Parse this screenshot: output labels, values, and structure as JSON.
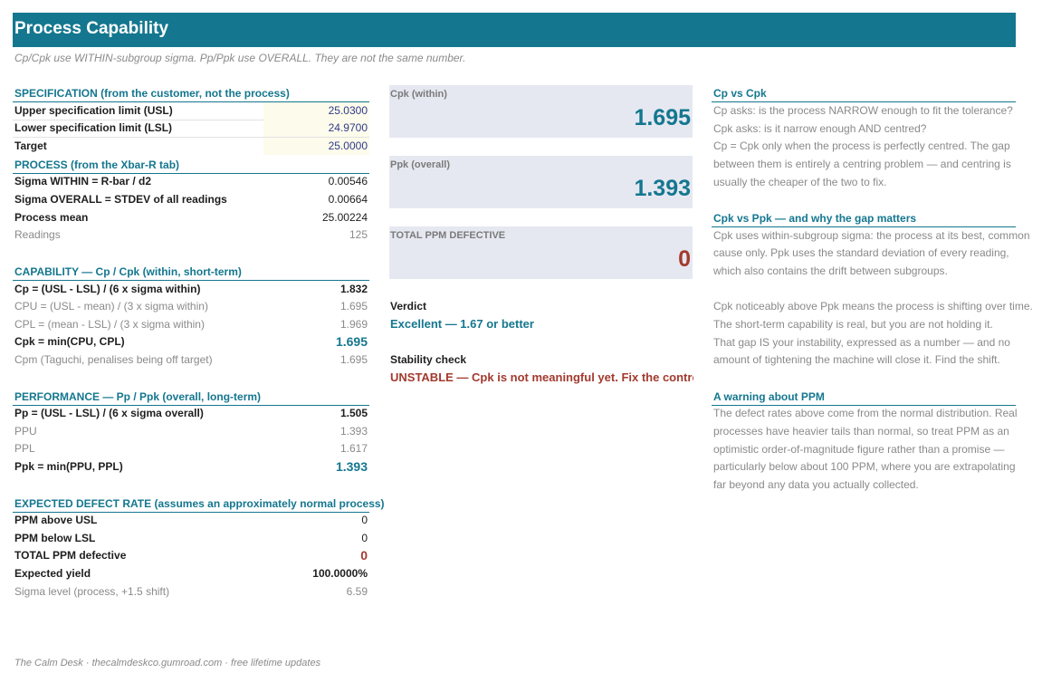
{
  "header": {
    "title": "Process Capability",
    "subtitle": "Cp/Cpk use WITHIN-subgroup sigma. Pp/Ppk use OVERALL. They are not the same number."
  },
  "specification": {
    "heading": "SPECIFICATION  (from the customer, not the process)",
    "usl_label": "Upper specification limit (USL)",
    "usl_value": "25.0300",
    "lsl_label": "Lower specification limit (LSL)",
    "lsl_value": "24.9700",
    "target_label": "Target",
    "target_value": "25.0000"
  },
  "process": {
    "heading": "PROCESS  (from the Xbar-R tab)",
    "sigma_within_label": "Sigma WITHIN  =  R-bar / d2",
    "sigma_within_value": "0.00546",
    "sigma_overall_label": "Sigma OVERALL  =  STDEV of all readings",
    "sigma_overall_value": "0.00664",
    "mean_label": "Process mean",
    "mean_value": "25.00224",
    "readings_label": "Readings",
    "readings_value": "125"
  },
  "capability": {
    "heading": "CAPABILITY  —  Cp / Cpk  (within, short-term)",
    "cp_label": "Cp   =  (USL - LSL) / (6 x sigma within)",
    "cp_value": "1.832",
    "cpu_label": "CPU  =  (USL - mean) / (3 x sigma within)",
    "cpu_value": "1.695",
    "cpl_label": "CPL  =  (mean - LSL) / (3 x sigma within)",
    "cpl_value": "1.969",
    "cpk_label": "Cpk  =  min(CPU, CPL)",
    "cpk_value": "1.695",
    "cpm_label": "Cpm  (Taguchi, penalises being off target)",
    "cpm_value": "1.695"
  },
  "performance": {
    "heading": "PERFORMANCE  —  Pp / Ppk  (overall, long-term)",
    "pp_label": "Pp   =  (USL - LSL) / (6 x sigma overall)",
    "pp_value": "1.505",
    "ppu_label": "PPU",
    "ppu_value": "1.393",
    "ppl_label": "PPL",
    "ppl_value": "1.617",
    "ppk_label": "Ppk  =  min(PPU, PPL)",
    "ppk_value": "1.393"
  },
  "defects": {
    "heading": "EXPECTED DEFECT RATE  (assumes an approximately normal process)",
    "above_label": "PPM above USL",
    "above_value": "0",
    "below_label": "PPM below LSL",
    "below_value": "0",
    "total_label": "TOTAL PPM defective",
    "total_value": "0",
    "yield_label": "Expected yield",
    "yield_value": "100.0000%",
    "sigma_label": "Sigma level (process, +1.5 shift)",
    "sigma_value": "6.59"
  },
  "cards": {
    "cpk_label": "Cpk  (within)",
    "cpk_value": "1.695",
    "ppk_label": "Ppk  (overall)",
    "ppk_value": "1.393",
    "ppm_label": "TOTAL PPM DEFECTIVE",
    "ppm_value": "0"
  },
  "verdict": {
    "label": "Verdict",
    "value": "Excellent — 1.67 or better"
  },
  "stability": {
    "label": "Stability check",
    "value": "UNSTABLE — Cpk is not meaningful yet. Fix the control chart first."
  },
  "notes": {
    "cp_vs_cpk": {
      "heading": "Cp vs Cpk",
      "lines": [
        "Cp asks: is the process NARROW enough to fit the tolerance?",
        "Cpk asks: is it narrow enough AND centred?",
        "Cp = Cpk only when the process is perfectly centred. The gap",
        "between them is entirely a centring problem — and centring is",
        "usually the cheaper of the two to fix."
      ]
    },
    "cpk_vs_ppk": {
      "heading": "Cpk vs Ppk  —  and why the gap matters",
      "lines": [
        "Cpk uses within-subgroup sigma: the process at its best, common",
        "cause only. Ppk uses the standard deviation of every reading,",
        "which also contains the drift between subgroups.",
        "",
        "Cpk noticeably above Ppk means the process is shifting over time.",
        "The short-term capability is real, but you are not holding it.",
        "That gap IS your instability, expressed as a number — and no",
        "amount of tightening the machine will close it. Find the shift."
      ]
    },
    "ppm_warning": {
      "heading": "A warning about PPM",
      "lines": [
        "The defect rates above come from the normal distribution. Real",
        "processes have heavier tails than normal, so treat PPM as an",
        "optimistic order-of-magnitude figure rather than a promise —",
        "particularly below about 100 PPM, where you are extrapolating",
        "far beyond any data you actually collected."
      ]
    }
  },
  "footer": {
    "text": "The Calm Desk  ·  thecalmdeskco.gumroad.com  ·  free lifetime updates"
  }
}
